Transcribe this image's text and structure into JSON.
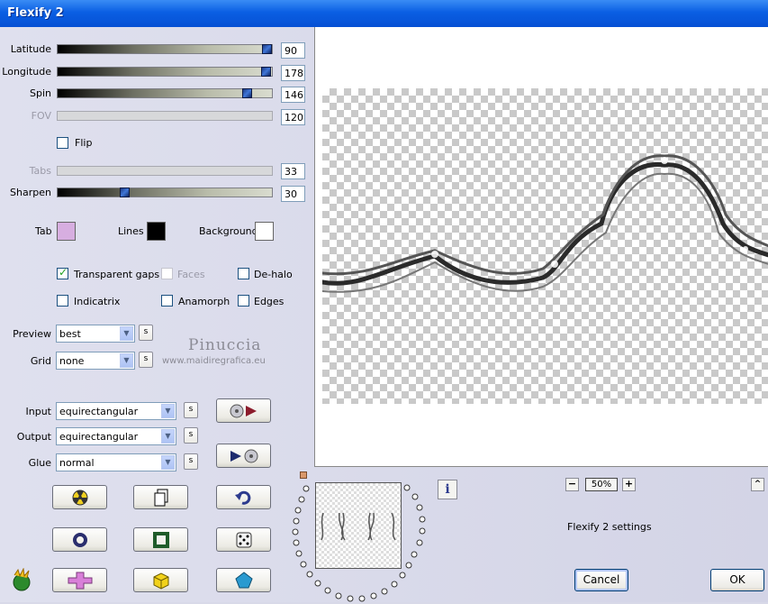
{
  "window": {
    "title": "Flexify 2"
  },
  "sliders": {
    "latitude": {
      "label": "Latitude",
      "value": "90"
    },
    "longitude": {
      "label": "Longitude",
      "value": "178"
    },
    "spin": {
      "label": "Spin",
      "value": "146"
    },
    "fov": {
      "label": "FOV",
      "value": "120"
    },
    "tabs": {
      "label": "Tabs",
      "value": "33"
    },
    "sharpen": {
      "label": "Sharpen",
      "value": "30"
    }
  },
  "checks": {
    "flip": {
      "label": "Flip",
      "checked": false
    },
    "transparent_gaps": {
      "label": "Transparent gaps",
      "checked": true
    },
    "faces": {
      "label": "Faces",
      "checked": false
    },
    "dehalo": {
      "label": "De-halo",
      "checked": false
    },
    "indicatrix": {
      "label": "Indicatrix",
      "checked": false
    },
    "anamorph": {
      "label": "Anamorph",
      "checked": false
    },
    "edges": {
      "label": "Edges",
      "checked": false
    }
  },
  "colors": {
    "tab": {
      "label": "Tab",
      "hex": "#d7aee0"
    },
    "lines": {
      "label": "Lines",
      "hex": "#000000"
    },
    "background": {
      "label": "Background",
      "hex": "#ffffff"
    }
  },
  "combos": {
    "preview": {
      "label": "Preview",
      "value": "best"
    },
    "grid": {
      "label": "Grid",
      "value": "none"
    },
    "input": {
      "label": "Input",
      "value": "equirectangular"
    },
    "output": {
      "label": "Output",
      "value": "equirectangular"
    },
    "glue": {
      "label": "Glue",
      "value": "normal"
    }
  },
  "s_label": "s",
  "watermark": {
    "name": "Pinuccia",
    "url": "www.maidiregrafica.eu"
  },
  "zoom": {
    "value": "50%",
    "minus": "−",
    "plus": "+"
  },
  "info_icon": "i",
  "collapse_label": "^",
  "settings_name": "Flexify 2 settings",
  "buttons": {
    "cancel": "Cancel",
    "ok": "OK"
  }
}
